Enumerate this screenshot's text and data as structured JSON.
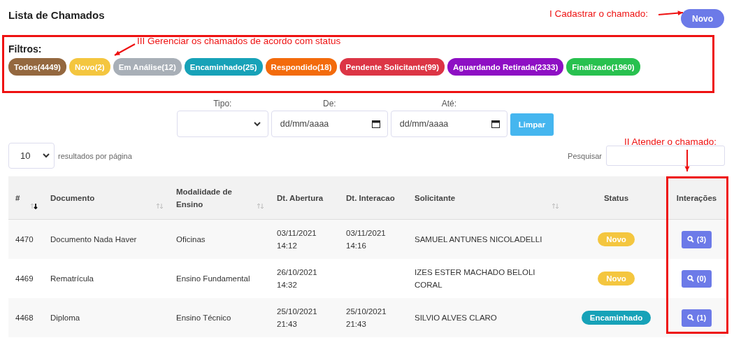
{
  "page": {
    "title": "Lista de Chamados"
  },
  "new_button": {
    "label": "Novo"
  },
  "filters": {
    "label": "Filtros:",
    "pills": [
      {
        "label": "Todos(4449)",
        "color": "#94683f"
      },
      {
        "label": "Novo(2)",
        "color": "#f4c63f"
      },
      {
        "label": "Em Análise(12)",
        "color": "#a8afb7"
      },
      {
        "label": "Encaminhado(25)",
        "color": "#17a2b8"
      },
      {
        "label": "Respondido(18)",
        "color": "#f36b0c"
      },
      {
        "label": "Pendente Solicitante(99)",
        "color": "#dc3545"
      },
      {
        "label": "Aguardando Retirada(2333)",
        "color": "#8e0fc4"
      },
      {
        "label": "Finalizado(1960)",
        "color": "#28c14f"
      }
    ]
  },
  "search_form": {
    "fields": [
      {
        "label": "Tipo:",
        "kind": "select"
      },
      {
        "label": "De:",
        "kind": "date",
        "placeholder": "dd/mm/aaaa"
      },
      {
        "label": "Até:",
        "kind": "date",
        "placeholder": "dd/mm/aaaa"
      }
    ],
    "clear_button": "Limpar"
  },
  "page_size": {
    "value": "10",
    "label": "resultados por página"
  },
  "search": {
    "label": "Pesquisar"
  },
  "table": {
    "columns": [
      {
        "label": "#",
        "sortable": true,
        "sorted": true
      },
      {
        "label": "Documento",
        "sortable": true,
        "sorted": false
      },
      {
        "label": "Modalidade de Ensino",
        "sortable": true,
        "sorted": false
      },
      {
        "label": "Dt. Abertura",
        "sortable": false
      },
      {
        "label": "Dt. Interacao",
        "sortable": false
      },
      {
        "label": "Solicitante",
        "sortable": true,
        "sorted": false
      },
      {
        "label": "Status",
        "sortable": false
      },
      {
        "label": "Interações",
        "sortable": false
      }
    ],
    "rows": [
      {
        "id": "4470",
        "document": "Documento Nada Haver",
        "modality": "Oficinas",
        "opened": [
          "03/11/2021",
          "14:12"
        ],
        "interacted": [
          "03/11/2021",
          "14:16"
        ],
        "requester": "SAMUEL ANTUNES NICOLADELLI",
        "status": {
          "label": "Novo",
          "color": "#f4c63f"
        },
        "interactions": "(3)"
      },
      {
        "id": "4469",
        "document": "Rematrícula",
        "modality": "Ensino Fundamental",
        "opened": [
          "26/10/2021",
          "14:32"
        ],
        "interacted": [],
        "requester": "IZES ESTER MACHADO BELOLI CORAL",
        "status": {
          "label": "Novo",
          "color": "#f4c63f"
        },
        "interactions": "(0)"
      },
      {
        "id": "4468",
        "document": "Diploma",
        "modality": "Ensino Técnico",
        "opened": [
          "25/10/2021",
          "21:43"
        ],
        "interacted": [
          "25/10/2021",
          "21:43"
        ],
        "requester": "SILVIO ALVES CLARO",
        "status": {
          "label": "Encaminhado",
          "color": "#17a2b8"
        },
        "interactions": "(1)"
      }
    ]
  },
  "annotations": [
    {
      "text": "I Cadastrar o chamado:"
    },
    {
      "text": "III Gerenciar os chamados de acordo com status"
    },
    {
      "text": "II Atender o chamado:"
    }
  ]
}
